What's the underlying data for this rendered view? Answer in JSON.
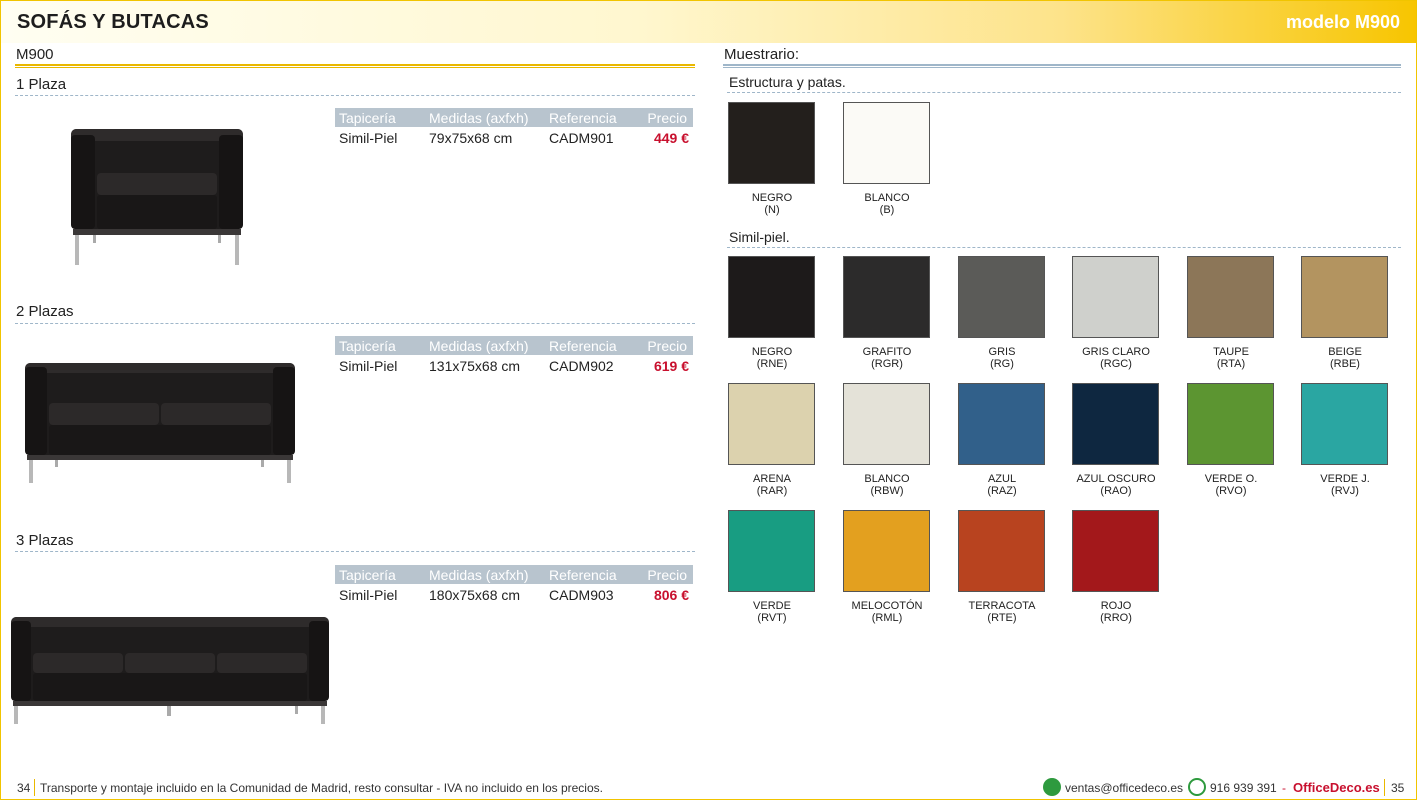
{
  "header": {
    "title": "SOFÁS Y BUTACAS",
    "model": "modelo M900"
  },
  "left": {
    "model_name": "M900",
    "table_headers": [
      "Tapicería",
      "Medidas (axfxh)",
      "Referencia",
      "Precio"
    ],
    "products": [
      {
        "label": "1 Plaza",
        "upholstery": "Simil-Piel",
        "size": "79x75x68 cm",
        "ref": "CADM901",
        "price": "449 €"
      },
      {
        "label": "2 Plazas",
        "upholstery": "Simil-Piel",
        "size": "131x75x68 cm",
        "ref": "CADM902",
        "price": "619 €"
      },
      {
        "label": "3 Plazas",
        "upholstery": "Simil-Piel",
        "size": "180x75x68 cm",
        "ref": "CADM903",
        "price": "806 €"
      }
    ]
  },
  "right": {
    "title": "Muestrario:",
    "structure_label": "Estructura y patas.",
    "structure": [
      {
        "name": "NEGRO",
        "code": "(N)",
        "color": "#231f1c"
      },
      {
        "name": "BLANCO",
        "code": "(B)",
        "color": "#fbfaf6"
      }
    ],
    "simil_label": "Simil-piel.",
    "simil": [
      {
        "name": "NEGRO",
        "code": "(RNE)",
        "color": "#1d1a1a"
      },
      {
        "name": "GRAFITO",
        "code": "(RGR)",
        "color": "#2c2b2b"
      },
      {
        "name": "GRIS",
        "code": "(RG)",
        "color": "#5b5b58"
      },
      {
        "name": "GRIS CLARO",
        "code": "(RGC)",
        "color": "#cfd0cc"
      },
      {
        "name": "TAUPE",
        "code": "(RTA)",
        "color": "#8c7658"
      },
      {
        "name": "BEIGE",
        "code": "(RBE)",
        "color": "#b39460"
      },
      {
        "name": "ARENA",
        "code": "(RAR)",
        "color": "#dcd2ae"
      },
      {
        "name": "BLANCO",
        "code": "(RBW)",
        "color": "#e4e2d8"
      },
      {
        "name": "AZUL",
        "code": "(RAZ)",
        "color": "#31608a"
      },
      {
        "name": "AZUL OSCURO",
        "code": "(RAO)",
        "color": "#0e2740"
      },
      {
        "name": "VERDE O.",
        "code": "(RVO)",
        "color": "#5c9531"
      },
      {
        "name": "VERDE J.",
        "code": "(RVJ)",
        "color": "#2aa6a2"
      },
      {
        "name": "VERDE",
        "code": "(RVT)",
        "color": "#189d82"
      },
      {
        "name": "MELOCOTÓN",
        "code": "(RML)",
        "color": "#e3a01f"
      },
      {
        "name": "TERRACOTA",
        "code": "(RTE)",
        "color": "#b8431f"
      },
      {
        "name": "ROJO",
        "code": "(RRO)",
        "color": "#a3181b"
      }
    ]
  },
  "footer": {
    "page_left": "34",
    "note": "Transporte y montaje incluido en la Comunidad de Madrid, resto consultar - IVA no incluido en los precios.",
    "email": "ventas@officedeco.es",
    "phone": "916 939 391",
    "dash": "-",
    "brand": "OfficeDeco.es",
    "page_right": "35"
  }
}
